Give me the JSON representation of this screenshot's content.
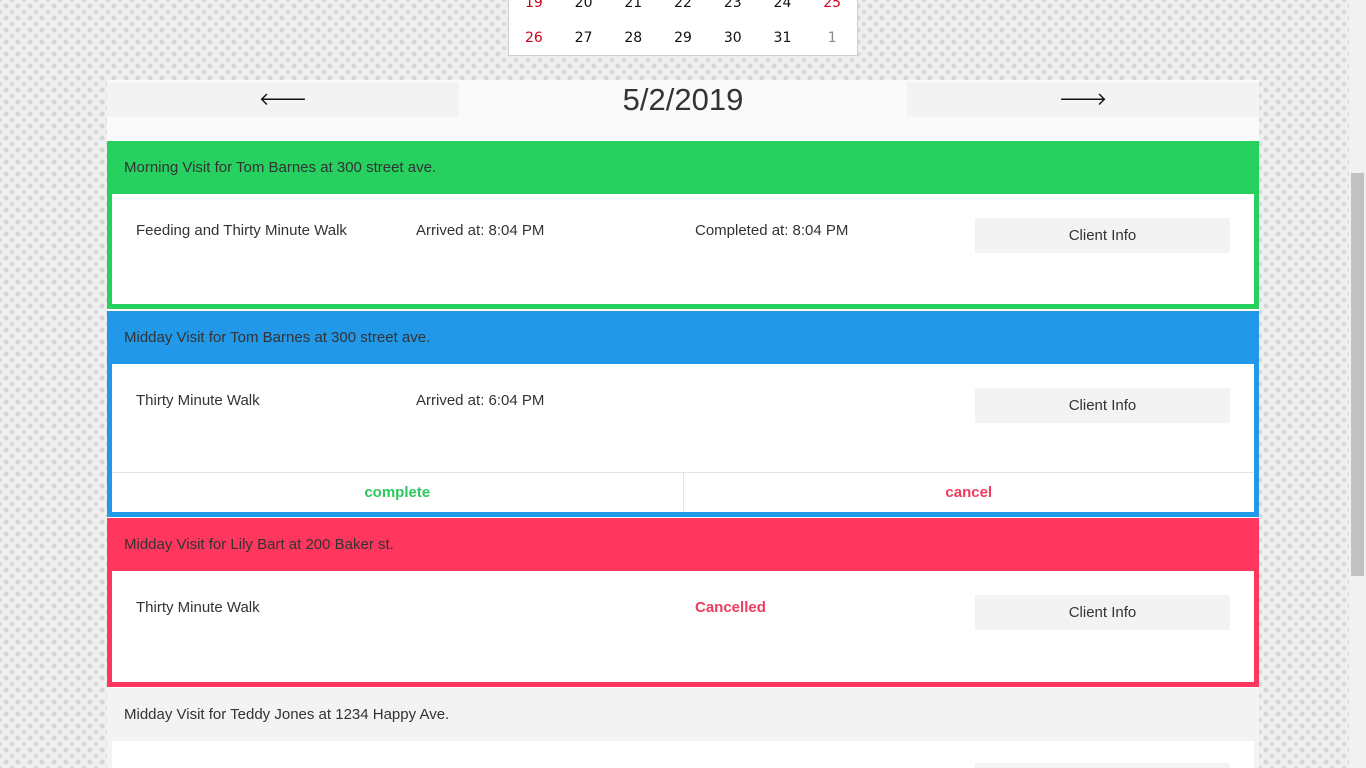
{
  "calendar": {
    "rows": [
      [
        "19",
        "20",
        "21",
        "22",
        "23",
        "24",
        "25"
      ],
      [
        "26",
        "27",
        "28",
        "29",
        "30",
        "31",
        "1"
      ]
    ]
  },
  "date_nav": {
    "prev_icon": "arrow-left-icon",
    "prev_glyph": "🡐",
    "next_icon": "arrow-right-icon",
    "next_glyph": "🡒",
    "current_date": "5/2/2019"
  },
  "visits": [
    {
      "header": "Morning Visit for Tom Barnes at 300 street ave.",
      "service": "Feeding and Thirty Minute Walk",
      "arrived": "Arrived at: 8:04 PM",
      "completed": "Completed at: 8:04 PM",
      "client_info_label": "Client Info",
      "color": "#26d160"
    },
    {
      "header": "Midday Visit for Tom Barnes at 300 street ave.",
      "service": "Thirty Minute Walk",
      "arrived": "Arrived at: 6:04 PM",
      "client_info_label": "Client Info",
      "complete_label": "complete",
      "cancel_label": "cancel",
      "color": "#2199e8"
    },
    {
      "header": "Midday Visit for Lily Bart at 200 Baker st.",
      "service": "Thirty Minute Walk",
      "status": "Cancelled",
      "client_info_label": "Client Info",
      "color": "#ff365d"
    },
    {
      "header": "Midday Visit for Teddy Jones at 1234 Happy Ave.",
      "color": "#f3f3f3"
    }
  ]
}
